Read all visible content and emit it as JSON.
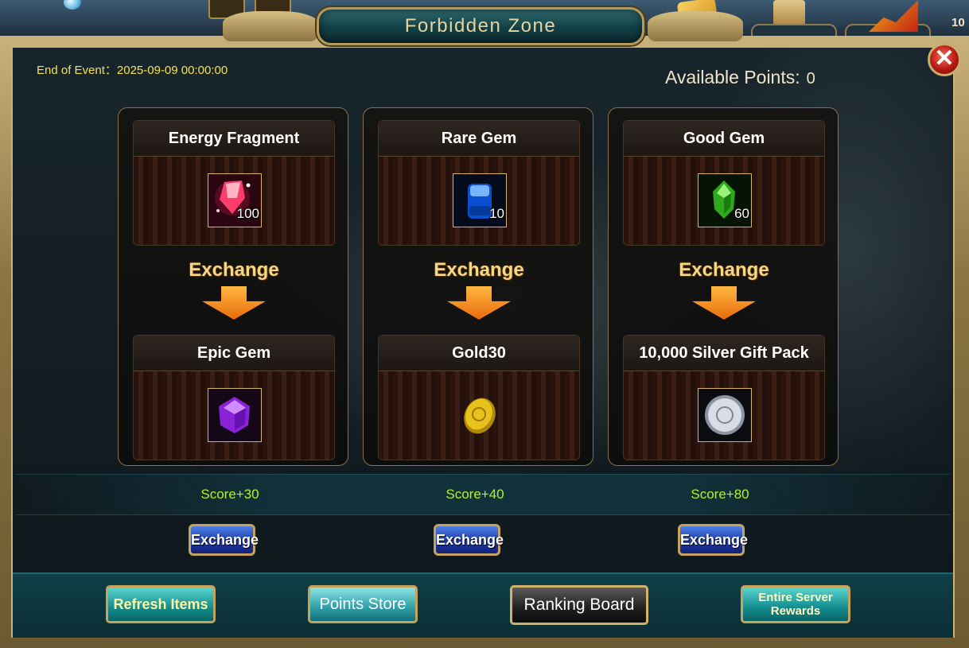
{
  "dialog": {
    "title": "Forbidden Zone",
    "end_of_event": "End of Event：2025-09-09 00:00:00",
    "available_points_label": "Available Points:",
    "available_points_value": "0",
    "close_icon": "close-icon"
  },
  "hud": {
    "corner_number": "10"
  },
  "offers": [
    {
      "cost_item": "Energy Fragment",
      "cost_qty": "100",
      "cost_icon": "energy-fragment-icon",
      "exchange_label": "Exchange",
      "reward_item": "Epic Gem",
      "reward_icon": "epic-gem-icon",
      "score": "Score+30",
      "button": "Exchange"
    },
    {
      "cost_item": "Rare Gem",
      "cost_qty": "10",
      "cost_icon": "rare-gem-icon",
      "exchange_label": "Exchange",
      "reward_item": "Gold30",
      "reward_icon": "gold-coin-icon",
      "score": "Score+40",
      "button": "Exchange"
    },
    {
      "cost_item": "Good Gem",
      "cost_qty": "60",
      "cost_icon": "good-gem-icon",
      "exchange_label": "Exchange",
      "reward_item": "10,000 Silver Gift Pack",
      "reward_icon": "silver-coin-icon",
      "score": "Score+80",
      "button": "Exchange"
    }
  ],
  "footer": {
    "refresh_items": "Refresh Items",
    "points_store": "Points Store",
    "ranking_board": "Ranking Board",
    "entire_server_line1": "Entire Server",
    "entire_server_line2": "Rewards"
  },
  "colors": {
    "score_green": "#b7f21c",
    "event_yellow": "#f3e24a",
    "exchange_gold": "#f5d786"
  }
}
